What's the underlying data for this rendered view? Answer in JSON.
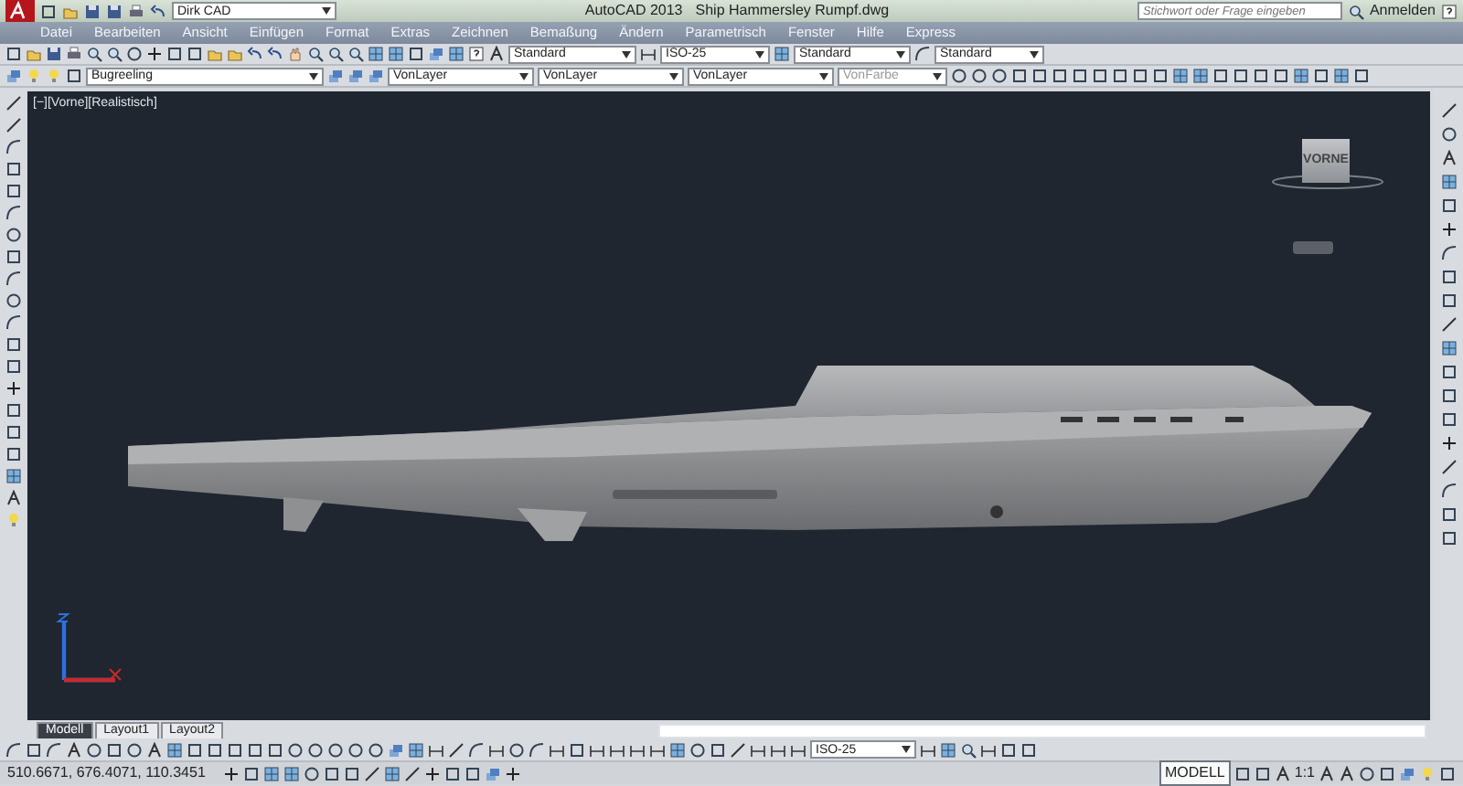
{
  "title_bar": {
    "workspace": "Dirk CAD",
    "app_title": "AutoCAD 2013",
    "file_name": "Ship Hammersley Rumpf.dwg",
    "search": {
      "placeholder": "Stichwort oder Frage eingeben"
    },
    "sign_in": "Anmelden"
  },
  "menu_bar": {
    "items": [
      "Datei",
      "Bearbeiten",
      "Ansicht",
      "Einfügen",
      "Format",
      "Extras",
      "Zeichnen",
      "Bemaßung",
      "Ändern",
      "Parametrisch",
      "Fenster",
      "Hilfe",
      "Express"
    ]
  },
  "styles_toolbar": {
    "text_style": "Standard",
    "dim_style": "ISO-25",
    "table_style": "Standard",
    "multileader_style": "Standard"
  },
  "layers_toolbar": {
    "layer": "Bugreeling",
    "object_color": "VonLayer",
    "linetype": "VonLayer",
    "lineweight": "VonLayer",
    "plot_style": "VonFarbe",
    "plot_style_disabled": true
  },
  "viewport": {
    "label": "[−][Vorne][Realistisch]",
    "viewcube_face": "VORNE"
  },
  "layout_tabs": [
    {
      "label": "Modell",
      "selected": true
    },
    {
      "label": "Layout1",
      "selected": false
    },
    {
      "label": "Layout2",
      "selected": false
    }
  ],
  "bottom_toolbar": {
    "dim_style": "ISO-25"
  },
  "status_bar": {
    "coordinates": "510.6671, 676.4071, 110.3451",
    "space": "MODELL",
    "scale": "1:1"
  }
}
